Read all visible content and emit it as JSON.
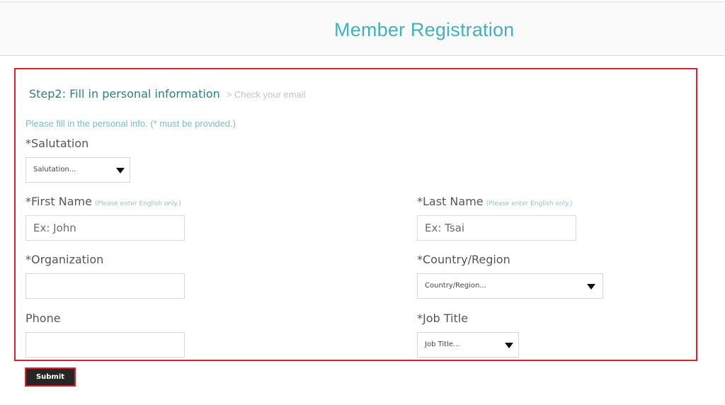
{
  "header": {
    "title": "Member Registration"
  },
  "form": {
    "step_current": "Step2: Fill in personal information",
    "step_next": "> Check your email",
    "note": "Please fill in the personal info. (* must be provided.)",
    "salutation": {
      "label": "*Salutation",
      "value": "Salutation..."
    },
    "first_name": {
      "label": "*First Name",
      "hint": "(Please enter English only.)",
      "placeholder": "Ex: John"
    },
    "last_name": {
      "label": "*Last Name",
      "hint": "(Please enter English only.)",
      "placeholder": "Ex: Tsai"
    },
    "organization": {
      "label": "*Organization",
      "placeholder": ""
    },
    "country": {
      "label": "*Country/Region",
      "value": "Country/Region..."
    },
    "phone": {
      "label": "Phone",
      "placeholder": ""
    },
    "job_title": {
      "label": "*Job Title",
      "value": "Job Title..."
    },
    "submit_label": "Submit"
  },
  "colors": {
    "accent": "#3fb3b8",
    "highlight": "#e0202a",
    "button": "#262626"
  }
}
